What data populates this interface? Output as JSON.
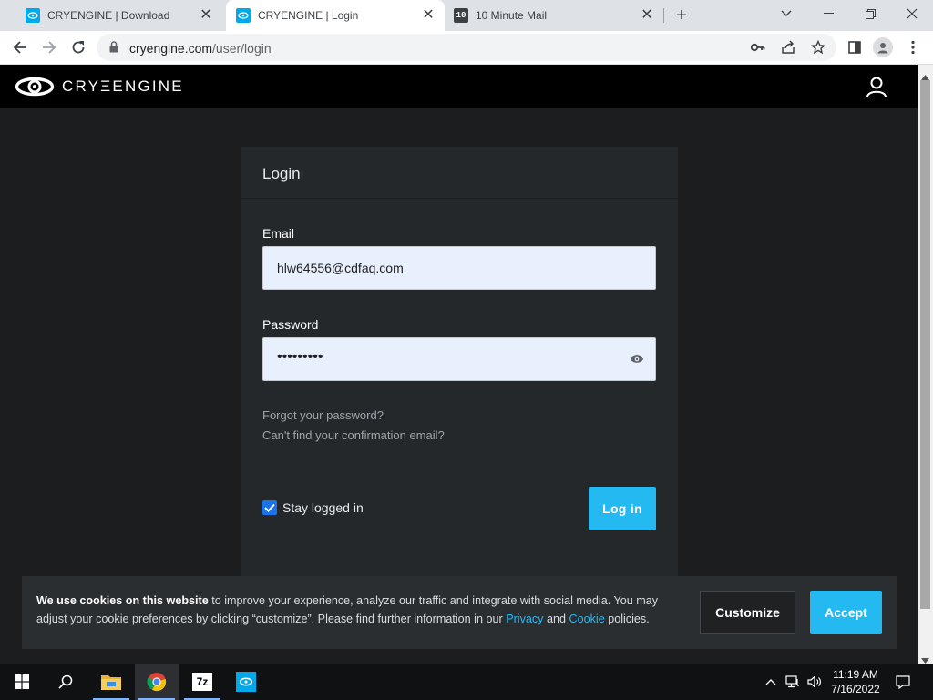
{
  "browser": {
    "tabs": [
      {
        "title": "CRYENGINE | Download",
        "favicon": "cryengine-favicon",
        "active": false
      },
      {
        "title": "CRYENGINE | Login",
        "favicon": "cryengine-favicon",
        "active": true
      },
      {
        "title": "10 Minute Mail",
        "favicon": "10minutemail-favicon",
        "favicon_text": "10",
        "active": false
      }
    ],
    "url_domain": "cryengine.com",
    "url_path": "/user/login"
  },
  "site": {
    "logo_text": "CRYΞENGINE",
    "accent_color": "#25b9f2"
  },
  "login": {
    "heading": "Login",
    "email_label": "Email",
    "email_value": "hlw64556@cdfaq.com",
    "password_label": "Password",
    "password_value": "•••••••••",
    "forgot_link": "Forgot your password?",
    "confirm_link": "Can't find your confirmation email?",
    "stay_logged_label": "Stay logged in",
    "stay_logged_checked": true,
    "login_button": "Log in"
  },
  "cookie": {
    "bold": "We use cookies on this website",
    "text1": " to improve your experience, analyze our traffic and integrate with social media. You may adjust your cookie preferences by clicking “customize”. Please find further information in our ",
    "privacy_link": "Privacy",
    "and": " and ",
    "cookie_link": "Cookie",
    "text2": " policies.",
    "customize_button": "Customize",
    "accept_button": "Accept"
  },
  "taskbar": {
    "time": "11:19 AM",
    "date": "7/16/2022",
    "sevenzip_label": "7z"
  }
}
